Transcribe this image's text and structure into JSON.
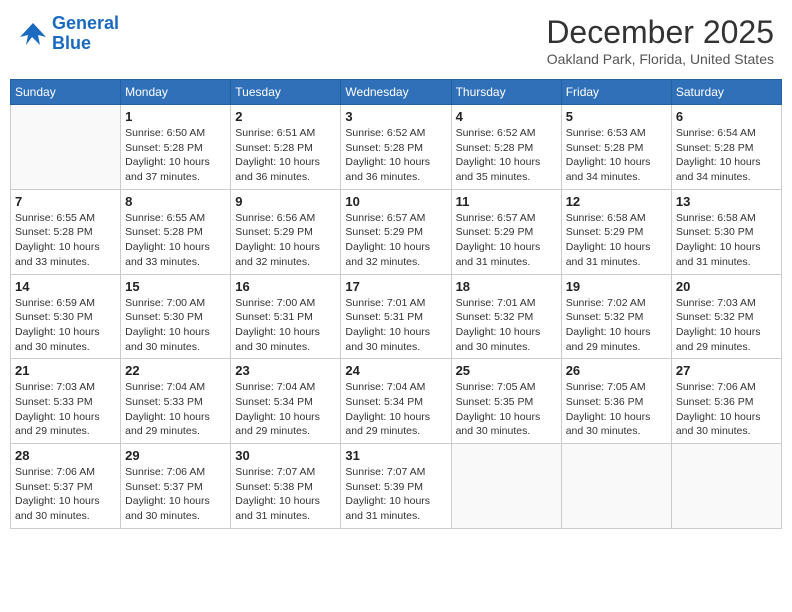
{
  "header": {
    "logo_line1": "General",
    "logo_line2": "Blue",
    "month": "December 2025",
    "location": "Oakland Park, Florida, United States"
  },
  "weekdays": [
    "Sunday",
    "Monday",
    "Tuesday",
    "Wednesday",
    "Thursday",
    "Friday",
    "Saturday"
  ],
  "weeks": [
    [
      {
        "day": "",
        "info": ""
      },
      {
        "day": "1",
        "info": "Sunrise: 6:50 AM\nSunset: 5:28 PM\nDaylight: 10 hours\nand 37 minutes."
      },
      {
        "day": "2",
        "info": "Sunrise: 6:51 AM\nSunset: 5:28 PM\nDaylight: 10 hours\nand 36 minutes."
      },
      {
        "day": "3",
        "info": "Sunrise: 6:52 AM\nSunset: 5:28 PM\nDaylight: 10 hours\nand 36 minutes."
      },
      {
        "day": "4",
        "info": "Sunrise: 6:52 AM\nSunset: 5:28 PM\nDaylight: 10 hours\nand 35 minutes."
      },
      {
        "day": "5",
        "info": "Sunrise: 6:53 AM\nSunset: 5:28 PM\nDaylight: 10 hours\nand 34 minutes."
      },
      {
        "day": "6",
        "info": "Sunrise: 6:54 AM\nSunset: 5:28 PM\nDaylight: 10 hours\nand 34 minutes."
      }
    ],
    [
      {
        "day": "7",
        "info": "Sunrise: 6:55 AM\nSunset: 5:28 PM\nDaylight: 10 hours\nand 33 minutes."
      },
      {
        "day": "8",
        "info": "Sunrise: 6:55 AM\nSunset: 5:28 PM\nDaylight: 10 hours\nand 33 minutes."
      },
      {
        "day": "9",
        "info": "Sunrise: 6:56 AM\nSunset: 5:29 PM\nDaylight: 10 hours\nand 32 minutes."
      },
      {
        "day": "10",
        "info": "Sunrise: 6:57 AM\nSunset: 5:29 PM\nDaylight: 10 hours\nand 32 minutes."
      },
      {
        "day": "11",
        "info": "Sunrise: 6:57 AM\nSunset: 5:29 PM\nDaylight: 10 hours\nand 31 minutes."
      },
      {
        "day": "12",
        "info": "Sunrise: 6:58 AM\nSunset: 5:29 PM\nDaylight: 10 hours\nand 31 minutes."
      },
      {
        "day": "13",
        "info": "Sunrise: 6:58 AM\nSunset: 5:30 PM\nDaylight: 10 hours\nand 31 minutes."
      }
    ],
    [
      {
        "day": "14",
        "info": "Sunrise: 6:59 AM\nSunset: 5:30 PM\nDaylight: 10 hours\nand 30 minutes."
      },
      {
        "day": "15",
        "info": "Sunrise: 7:00 AM\nSunset: 5:30 PM\nDaylight: 10 hours\nand 30 minutes."
      },
      {
        "day": "16",
        "info": "Sunrise: 7:00 AM\nSunset: 5:31 PM\nDaylight: 10 hours\nand 30 minutes."
      },
      {
        "day": "17",
        "info": "Sunrise: 7:01 AM\nSunset: 5:31 PM\nDaylight: 10 hours\nand 30 minutes."
      },
      {
        "day": "18",
        "info": "Sunrise: 7:01 AM\nSunset: 5:32 PM\nDaylight: 10 hours\nand 30 minutes."
      },
      {
        "day": "19",
        "info": "Sunrise: 7:02 AM\nSunset: 5:32 PM\nDaylight: 10 hours\nand 29 minutes."
      },
      {
        "day": "20",
        "info": "Sunrise: 7:03 AM\nSunset: 5:32 PM\nDaylight: 10 hours\nand 29 minutes."
      }
    ],
    [
      {
        "day": "21",
        "info": "Sunrise: 7:03 AM\nSunset: 5:33 PM\nDaylight: 10 hours\nand 29 minutes."
      },
      {
        "day": "22",
        "info": "Sunrise: 7:04 AM\nSunset: 5:33 PM\nDaylight: 10 hours\nand 29 minutes."
      },
      {
        "day": "23",
        "info": "Sunrise: 7:04 AM\nSunset: 5:34 PM\nDaylight: 10 hours\nand 29 minutes."
      },
      {
        "day": "24",
        "info": "Sunrise: 7:04 AM\nSunset: 5:34 PM\nDaylight: 10 hours\nand 29 minutes."
      },
      {
        "day": "25",
        "info": "Sunrise: 7:05 AM\nSunset: 5:35 PM\nDaylight: 10 hours\nand 30 minutes."
      },
      {
        "day": "26",
        "info": "Sunrise: 7:05 AM\nSunset: 5:36 PM\nDaylight: 10 hours\nand 30 minutes."
      },
      {
        "day": "27",
        "info": "Sunrise: 7:06 AM\nSunset: 5:36 PM\nDaylight: 10 hours\nand 30 minutes."
      }
    ],
    [
      {
        "day": "28",
        "info": "Sunrise: 7:06 AM\nSunset: 5:37 PM\nDaylight: 10 hours\nand 30 minutes."
      },
      {
        "day": "29",
        "info": "Sunrise: 7:06 AM\nSunset: 5:37 PM\nDaylight: 10 hours\nand 30 minutes."
      },
      {
        "day": "30",
        "info": "Sunrise: 7:07 AM\nSunset: 5:38 PM\nDaylight: 10 hours\nand 31 minutes."
      },
      {
        "day": "31",
        "info": "Sunrise: 7:07 AM\nSunset: 5:39 PM\nDaylight: 10 hours\nand 31 minutes."
      },
      {
        "day": "",
        "info": ""
      },
      {
        "day": "",
        "info": ""
      },
      {
        "day": "",
        "info": ""
      }
    ]
  ]
}
